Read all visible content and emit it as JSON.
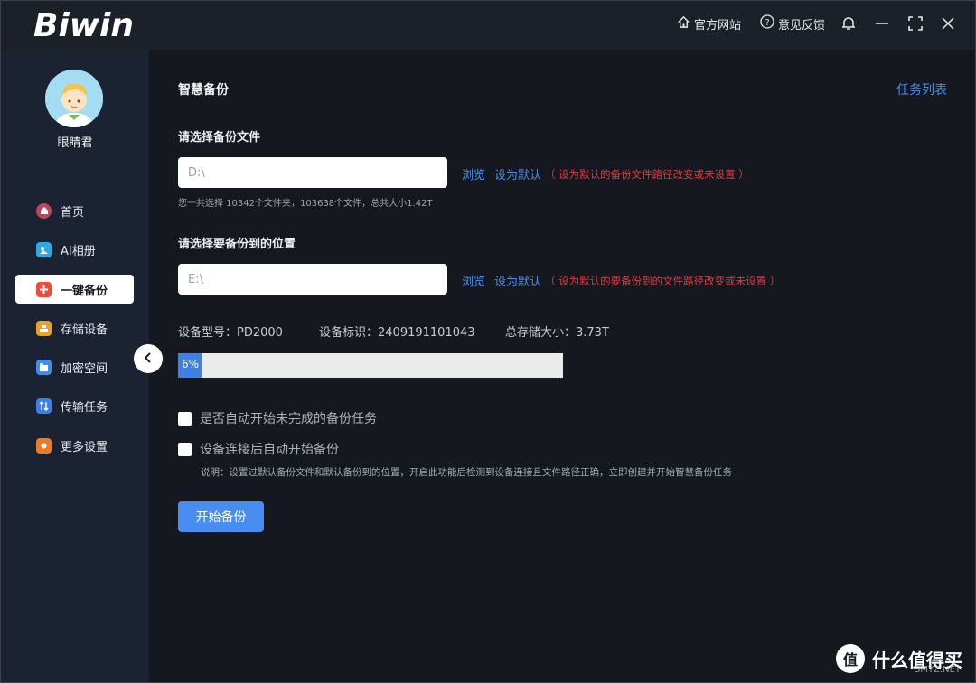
{
  "titlebar": {
    "logo": "Biwin",
    "official_site": "官方网站",
    "feedback": "意见反馈",
    "icons": [
      "home-icon",
      "help-icon",
      "bell-icon",
      "minimize-icon",
      "fullscreen-icon",
      "close-icon"
    ]
  },
  "sidebar": {
    "username": "眼睛君",
    "items": [
      {
        "label": "首页",
        "icon": "home-icon",
        "color": "#c2455e"
      },
      {
        "label": "AI相册",
        "icon": "album-icon",
        "color": "#2ea8e6"
      },
      {
        "label": "一键备份",
        "icon": "backup-icon",
        "color": "#f04a3a",
        "active": true
      },
      {
        "label": "存储设备",
        "icon": "storage-icon",
        "color": "#f0a020"
      },
      {
        "label": "加密空间",
        "icon": "encrypt-icon",
        "color": "#3a8ff0"
      },
      {
        "label": "传输任务",
        "icon": "transfer-icon",
        "color": "#3a7ff0"
      },
      {
        "label": "更多设置",
        "icon": "settings-icon",
        "color": "#f07a20"
      }
    ]
  },
  "main": {
    "title": "智慧备份",
    "task_list": "任务列表",
    "source": {
      "label": "请选择备份文件",
      "placeholder": "D:\\",
      "browse": "浏览",
      "set_default": "设为默认",
      "hint": "（ 设为默认的备份文件路径改变或未设置 ）",
      "summary": "您一共选择 10342个文件夹，103638个文件，总共大小1.42T"
    },
    "target": {
      "label": "请选择要备份到的位置",
      "placeholder": "E:\\",
      "browse": "浏览",
      "set_default": "设为默认",
      "hint": "（ 设为默认的要备份到的文件路径改变或未设置 ）"
    },
    "device": {
      "model": "设备型号：PD2000",
      "id": "设备标识：2409191101043",
      "capacity": "总存储大小：3.73T"
    },
    "progress": {
      "text": "6%",
      "value": 6
    },
    "options": {
      "auto_resume": "是否自动开始未完成的备份任务",
      "auto_on_connect": "设备连接后自动开始备份",
      "explain": "说明：设置过默认备份文件和默认备份到的位置，开启此功能后检测到设备连接且文件路径正确，立即创建并开始智慧备份任务"
    },
    "start_button": "开始备份"
  },
  "watermark": {
    "main": "什么值得买",
    "sub": "SMYZ.NET"
  },
  "colors": {
    "accent": "#4a8df0",
    "warning": "#e0393e",
    "sidebar_bg": "#1b2232",
    "main_bg": "#15191f"
  }
}
